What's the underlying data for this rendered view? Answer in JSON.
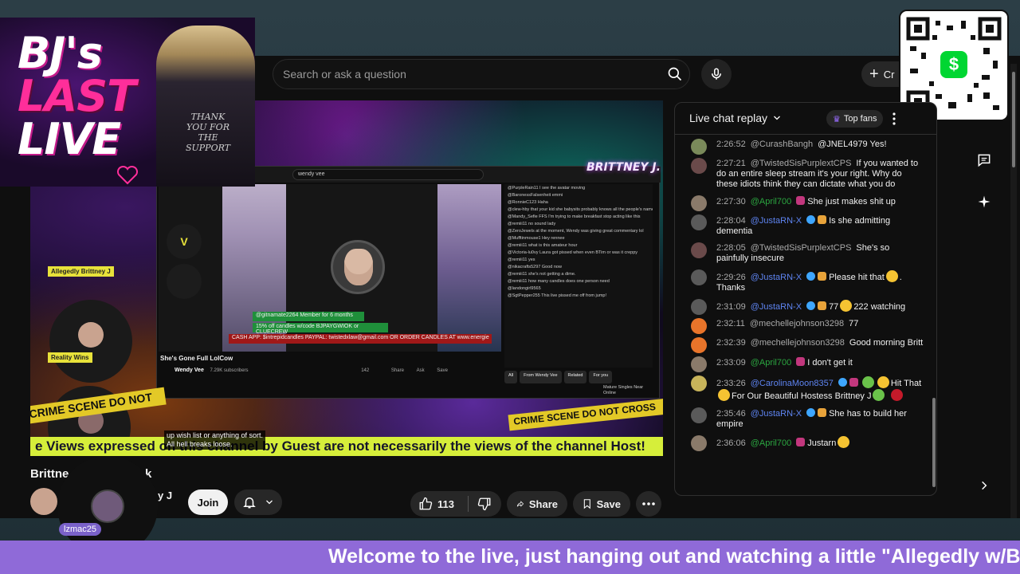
{
  "search": {
    "placeholder": "Search or ask a question"
  },
  "header": {
    "create_label": "Cr"
  },
  "overlay": {
    "logo_line1": "BJ's",
    "logo_line2": "LAST",
    "logo_line3": "LIVE",
    "jacket_text": "THANK YOU FOR THE SUPPORT",
    "qr_symbol": "$",
    "brand_tag": "BRITTNEY J."
  },
  "player": {
    "stage_labels": [
      "Allegedly Brittney J",
      "Reality Wins"
    ],
    "inner_search_text": "wendy vee",
    "inner_promo_member": "@gitnamate2264  Member for 6 months",
    "inner_promo_green": "15% off candles w/code BJPAYGWIOK or CLUECREW",
    "inner_promo_red": "CASH APP: $intrepidcandles PAYPAL: twistedxlaw@gmail.com OR ORDER CANDLES AT www.energie",
    "inner_video_title": "She's Gone Full LolCow",
    "inner_channel": "Wendy Vee",
    "inner_subs": "7.29K subscribers",
    "inner_likes": "142",
    "inner_actions": [
      "Share",
      "Ask",
      "Save"
    ],
    "inner_chat": [
      "@PurpleRain11  I see the avatar moving",
      "@BaronessFalsenheit  emmi",
      "@RonnieC123  Haha",
      "@clew-hby  that your kid she babysits probably knows all the people's names",
      "@Mandy_Sefie  FFS I'm trying to make breakfast stop acting like this",
      "@remiii11  no sound lady",
      "@ZeroJewels  at the moment, Wendy was giving great commentary lol",
      "@Mufftinmouse1  Hey rennee",
      "@remiii11  what is this amateur hour",
      "@Victoria-lu0vy  Laura got pissed when even BTim or was it creppy",
      "@remiii11  yes",
      "@nikacrafts5297  Good now",
      "@remiii11  she's not getting a dime.",
      "@remiii11  how many candles does one person need",
      "@landongirl9565",
      "@SgtPepper255  This live pissed me off from jump!"
    ],
    "inner_tabs": [
      "All",
      "From Wendy Vee",
      "Related",
      "For you"
    ],
    "inner_side_label": "Mature Singles Near Online",
    "crime_tape_left": "CRIME SCENE DO NOT",
    "crime_tape_right": "CRIME SCENE DO NOT CROSS",
    "ticker": "e Views expressed on this channel by Guest are not necessarily the views of the channel Host!",
    "captions": [
      "up wish list or anything of sort.",
      "All hell breaks loose."
    ]
  },
  "below": {
    "title_visible": "Brittne",
    "title_tail": "k",
    "channel_suffix": "y J",
    "guest_name": "lzmac25",
    "join_label": "Join",
    "like_count": "113",
    "share_label": "Share",
    "save_label": "Save"
  },
  "chat": {
    "title": "Live chat replay",
    "top_fans": "Top fans",
    "messages": [
      {
        "time": "2:26:52",
        "author": "@CurashBangh",
        "text": "@JNEL4979 Yes!",
        "role": "",
        "color": "#7a8a5a"
      },
      {
        "time": "2:27:21",
        "author": "@TwistedSisPurplextCPS",
        "text": "If you wanted to do an entire sleep stream it's your right. Why do these idiots think they can dictate what you do",
        "role": "",
        "color": "#6a4a4a"
      },
      {
        "time": "2:27:30",
        "author": "@April700",
        "text": "She just makes shit up",
        "role": "mem",
        "color": "#8a7a6a"
      },
      {
        "time": "2:28:04",
        "author": "@JustaRN-X",
        "text": "Is she admitting dementia",
        "role": "mod",
        "color": "#5a5a5a"
      },
      {
        "time": "2:28:05",
        "author": "@TwistedSisPurplextCPS",
        "text": "She's so painfully insecure",
        "role": "",
        "color": "#6a4a4a"
      },
      {
        "time": "2:29:26",
        "author": "@JustaRN-X",
        "text": "Please hit that",
        "text2": ". Thanks",
        "role": "mod",
        "color": "#5a5a5a"
      },
      {
        "time": "2:31:09",
        "author": "@JustaRN-X",
        "text": "77",
        "text2": "222 watching",
        "role": "mod",
        "color": "#5a5a5a"
      },
      {
        "time": "2:32:11",
        "author": "@mechellejohnson3298",
        "text": "77",
        "role": "",
        "color": "#e8742a"
      },
      {
        "time": "2:32:39",
        "author": "@mechellejohnson3298",
        "text": "Good morning Britt",
        "role": "",
        "color": "#e8742a"
      },
      {
        "time": "2:33:09",
        "author": "@April700",
        "text": "I don't get it",
        "role": "mem",
        "color": "#8a7a6a"
      },
      {
        "time": "2:33:26",
        "author": "@CarolinaMoon8357",
        "text": "Hit That",
        "text2": "For Our Beautiful Hostess Brittney J",
        "role": "mod",
        "color": "#c8b45a"
      },
      {
        "time": "2:35:46",
        "author": "@JustaRN-X",
        "text": "She has to build her empire",
        "role": "mod",
        "color": "#5a5a5a"
      },
      {
        "time": "2:36:06",
        "author": "@April700",
        "text": "Justarn",
        "role": "mem",
        "color": "#8a7a6a"
      }
    ]
  },
  "marquee": {
    "text": "Welcome to the live, just hanging out and watching a little \"Allegedly w/B"
  }
}
